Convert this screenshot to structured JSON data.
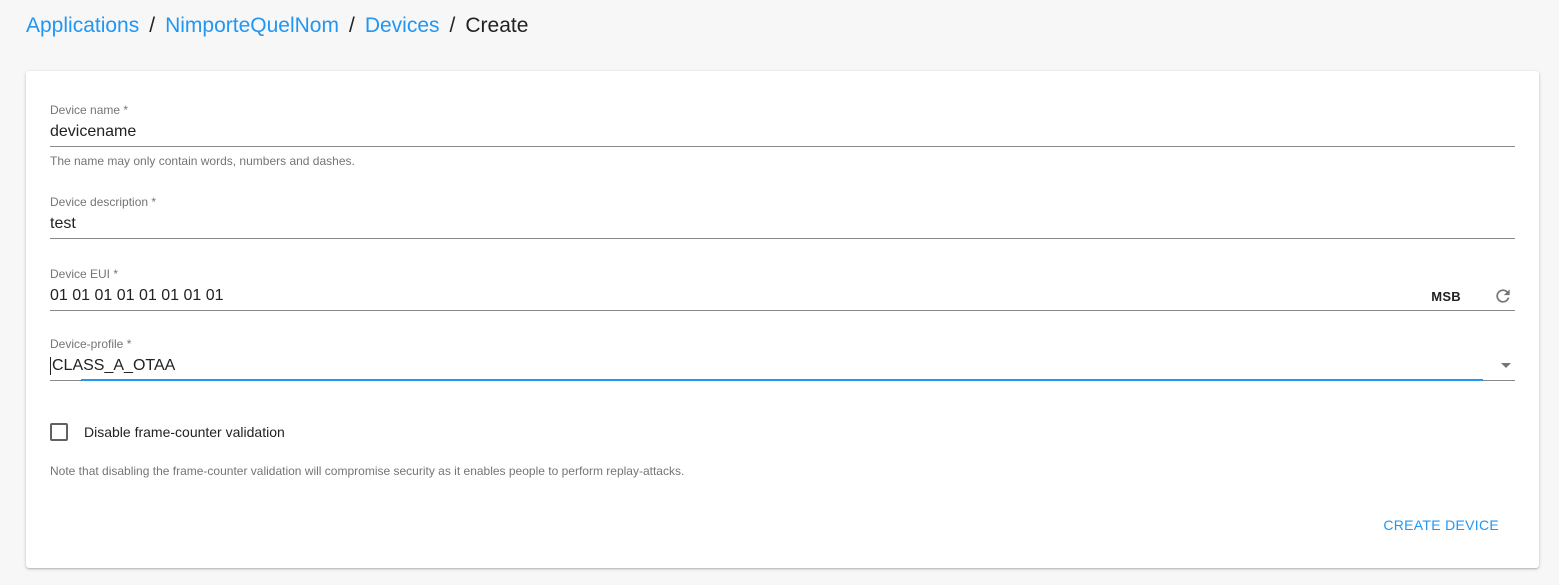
{
  "breadcrumb": {
    "items": [
      "Applications",
      "NimporteQuelNom",
      "Devices"
    ],
    "separator": "/",
    "current": "Create"
  },
  "form": {
    "device_name": {
      "label": "Device name *",
      "value": "devicename",
      "helper": "The name may only contain words, numbers and dashes."
    },
    "device_description": {
      "label": "Device description *",
      "value": "test"
    },
    "device_eui": {
      "label": "Device EUI *",
      "value": "01 01 01 01 01 01 01 01",
      "byte_order": "MSB",
      "regenerate_icon": "refresh-icon"
    },
    "device_profile": {
      "label": "Device-profile *",
      "value": "CLASS_A_OTAA"
    },
    "frame_counter": {
      "label": "Disable frame-counter validation",
      "checked": false,
      "note": "Note that disabling the frame-counter validation will compromise security as it enables people to perform replay-attacks."
    },
    "submit_label": "CREATE DEVICE"
  },
  "colors": {
    "accent": "#2196f3",
    "background": "#f7f7f7",
    "card": "#ffffff"
  }
}
